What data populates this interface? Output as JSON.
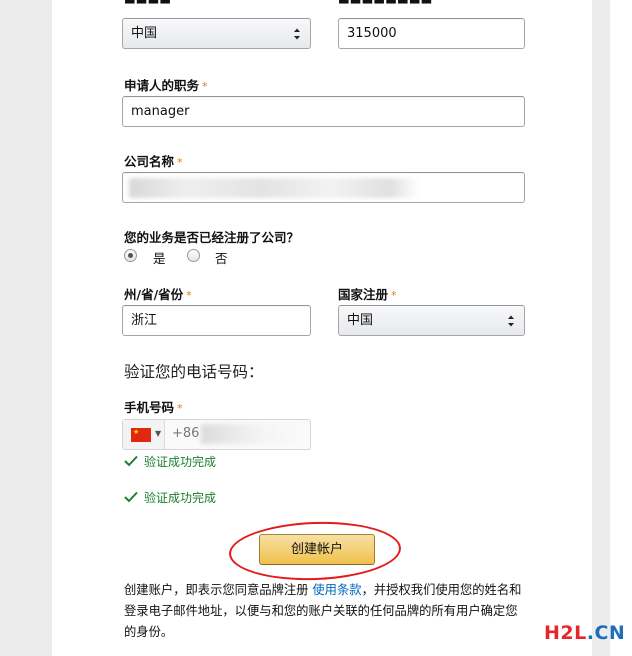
{
  "form": {
    "top_left_select": {
      "value": "中国"
    },
    "top_right_input": {
      "value": "315000"
    },
    "position": {
      "label": "申请人的职务",
      "required_mark": "*",
      "value": "manager"
    },
    "company_name": {
      "label": "公司名称",
      "required_mark": "*"
    },
    "registered": {
      "question": "您的业务是否已经注册了公司？",
      "options": [
        {
          "label": "是",
          "checked": true
        },
        {
          "label": "否",
          "checked": false
        }
      ]
    },
    "state": {
      "label": "州/省/省份",
      "required_mark": "*",
      "value": "浙江"
    },
    "country_registered": {
      "label": "国家注册",
      "required_mark": "*",
      "value": "中国"
    },
    "verify_title": "验证您的电话号码：",
    "mobile": {
      "label": "手机号码",
      "required_mark": "*",
      "dial_code": "+86",
      "flag_icon": "china-flag-icon"
    },
    "verify_messages": [
      "验证成功完成",
      "验证成功完成"
    ],
    "create_button": "创建帐户",
    "legal": {
      "before": "创建账户，即表示您同意品牌注册 ",
      "link": "使用条款",
      "after": "，并授权我们使用您的姓名和登录电子邮件地址，以便与和您的账户关联的任何品牌的所有用户确定您的身份。"
    }
  },
  "watermark": {
    "part1": "H2L",
    "part2": ".CN"
  },
  "colors": {
    "required": "#e47911",
    "success": "#1b7f2b",
    "link": "#0066c0",
    "button_top": "#f7dfa5",
    "button_bottom": "#f0c14b",
    "annotation_ellipse": "#e31b1b"
  }
}
